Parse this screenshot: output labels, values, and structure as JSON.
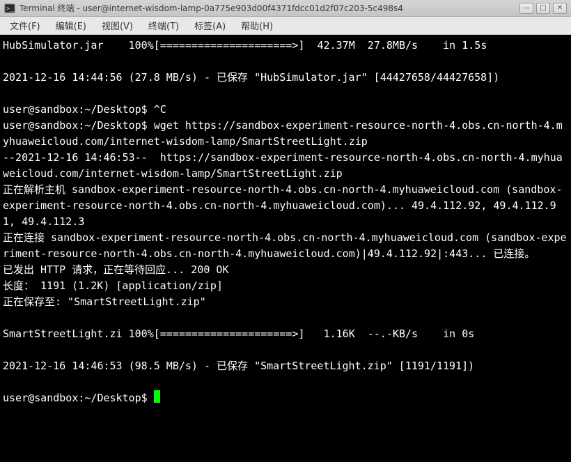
{
  "titlebar": {
    "icon_name": "terminal-icon",
    "title": "Terminal 终端 - user@internet-wisdom-lamp-0a775e903d00f4371fdcc01d2f07c203-5c498s4"
  },
  "winbtns": {
    "min": "—",
    "max": "□",
    "close": "✕"
  },
  "menubar": {
    "file": "文件(F)",
    "edit": "编辑(E)",
    "view": "视图(V)",
    "terminal": "终端(T)",
    "tabs": "标签(A)",
    "help": "帮助(H)"
  },
  "term": {
    "l1": "HubSimulator.jar    100%[=====================>]  42.37M  27.8MB/s    in 1.5s",
    "blank": "",
    "l2": "2021-12-16 14:44:56 (27.8 MB/s) - 已保存 \"HubSimulator.jar\" [44427658/44427658])",
    "prompt1": "user@sandbox:~/Desktop$ ^C",
    "prompt2a": "user@sandbox:~/Desktop$ wget https://sandbox-experiment-resource-north-4.obs.cn-north-4.myhuaweicloud.com/internet-wisdom-lamp/SmartStreetLight.zip",
    "l5": "--2021-12-16 14:46:53--  https://sandbox-experiment-resource-north-4.obs.cn-north-4.myhuaweicloud.com/internet-wisdom-lamp/SmartStreetLight.zip",
    "l6": "正在解析主机 sandbox-experiment-resource-north-4.obs.cn-north-4.myhuaweicloud.com (sandbox-experiment-resource-north-4.obs.cn-north-4.myhuaweicloud.com)... 49.4.112.92, 49.4.112.91, 49.4.112.3",
    "l7": "正在连接 sandbox-experiment-resource-north-4.obs.cn-north-4.myhuaweicloud.com (sandbox-experiment-resource-north-4.obs.cn-north-4.myhuaweicloud.com)|49.4.112.92|:443... 已连接。",
    "l8": "已发出 HTTP 请求，正在等待回应... 200 OK",
    "l9": "长度： 1191 (1.2K) [application/zip]",
    "l10": "正在保存至: \"SmartStreetLight.zip\"",
    "l11": "SmartStreetLight.zi 100%[=====================>]   1.16K  --.-KB/s    in 0s",
    "l12": "2021-12-16 14:46:53 (98.5 MB/s) - 已保存 \"SmartStreetLight.zip\" [1191/1191])",
    "prompt3": "user@sandbox:~/Desktop$ "
  }
}
